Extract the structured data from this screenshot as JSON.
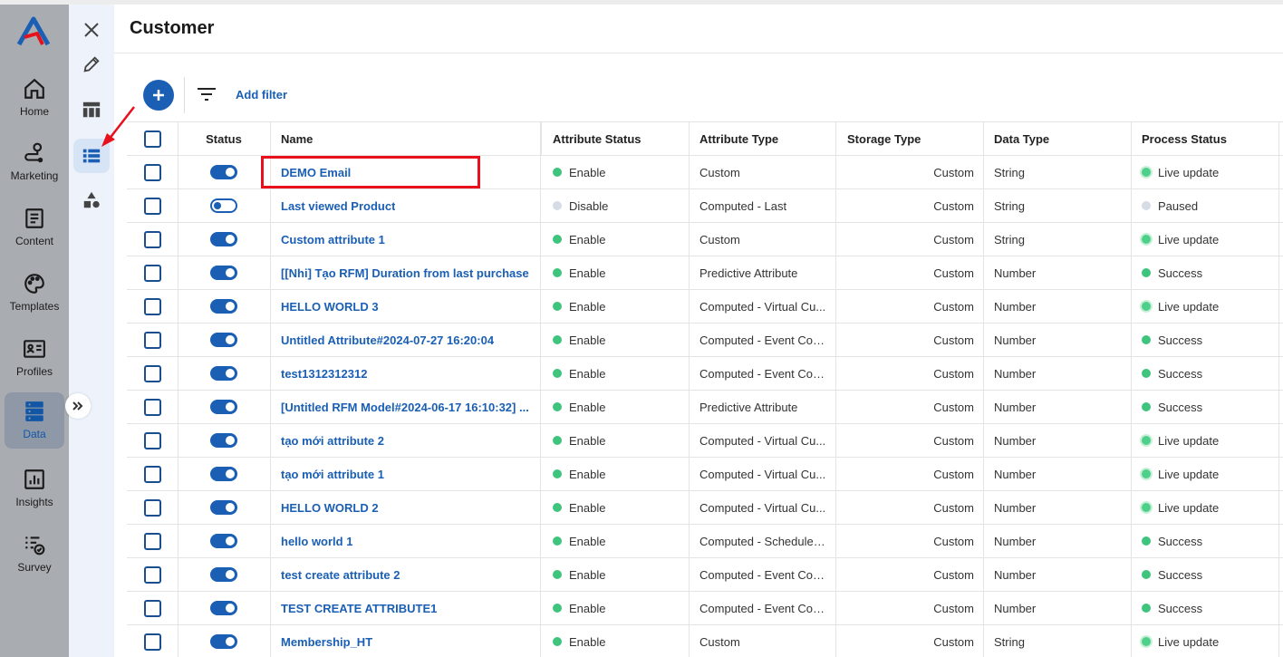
{
  "nav": {
    "items": [
      {
        "label": "Home",
        "icon": "home-icon"
      },
      {
        "label": "Marketing",
        "icon": "marketing-icon"
      },
      {
        "label": "Content",
        "icon": "content-icon"
      },
      {
        "label": "Templates",
        "icon": "palette-icon"
      },
      {
        "label": "Profiles",
        "icon": "profile-card-icon"
      },
      {
        "label": "Data",
        "icon": "database-icon"
      },
      {
        "label": "Insights",
        "icon": "chart-icon"
      },
      {
        "label": "Survey",
        "icon": "survey-icon"
      }
    ],
    "active": "Data"
  },
  "subnav": [
    "close-icon",
    "pencil-icon",
    "table-icon",
    "list-icon",
    "shapes-icon"
  ],
  "page": {
    "title": "Customer"
  },
  "toolbar": {
    "add_filter": "Add filter"
  },
  "table": {
    "headers": {
      "status": "Status",
      "name": "Name",
      "attribute_status": "Attribute Status",
      "attribute_type": "Attribute Type",
      "storage_type": "Storage Type",
      "data_type": "Data Type",
      "process_status": "Process Status"
    },
    "rows": [
      {
        "on": true,
        "name": "DEMO Email",
        "attr_status": "Enable",
        "attr_type": "Custom",
        "storage": "Custom",
        "data_type": "String",
        "process": "Live update"
      },
      {
        "on": false,
        "name": "Last viewed Product",
        "attr_status": "Disable",
        "attr_type": "Computed - Last",
        "storage": "Custom",
        "data_type": "String",
        "process": "Paused"
      },
      {
        "on": true,
        "name": "Custom attribute 1",
        "attr_status": "Enable",
        "attr_type": "Custom",
        "storage": "Custom",
        "data_type": "String",
        "process": "Live update"
      },
      {
        "on": true,
        "name": "[[Nhi] Tạo RFM] Duration from last purchase",
        "attr_status": "Enable",
        "attr_type": "Predictive Attribute",
        "storage": "Custom",
        "data_type": "Number",
        "process": "Success"
      },
      {
        "on": true,
        "name": "HELLO WORLD 3",
        "attr_status": "Enable",
        "attr_type": "Computed - Virtual Cu...",
        "storage": "Custom",
        "data_type": "Number",
        "process": "Live update"
      },
      {
        "on": true,
        "name": "Untitled Attribute#2024-07-27 16:20:04",
        "attr_status": "Enable",
        "attr_type": "Computed - Event Cou...",
        "storage": "Custom",
        "data_type": "Number",
        "process": "Success"
      },
      {
        "on": true,
        "name": "test1312312312",
        "attr_status": "Enable",
        "attr_type": "Computed - Event Cou...",
        "storage": "Custom",
        "data_type": "Number",
        "process": "Success"
      },
      {
        "on": true,
        "name": "[Untitled RFM Model#2024-06-17 16:10:32] ...",
        "attr_status": "Enable",
        "attr_type": "Predictive Attribute",
        "storage": "Custom",
        "data_type": "Number",
        "process": "Success"
      },
      {
        "on": true,
        "name": "tạo mới attribute 2",
        "attr_status": "Enable",
        "attr_type": "Computed - Virtual Cu...",
        "storage": "Custom",
        "data_type": "Number",
        "process": "Live update"
      },
      {
        "on": true,
        "name": "tạo mới attribute 1",
        "attr_status": "Enable",
        "attr_type": "Computed - Virtual Cu...",
        "storage": "Custom",
        "data_type": "Number",
        "process": "Live update"
      },
      {
        "on": true,
        "name": "HELLO WORLD 2",
        "attr_status": "Enable",
        "attr_type": "Computed - Virtual Cu...",
        "storage": "Custom",
        "data_type": "Number",
        "process": "Live update"
      },
      {
        "on": true,
        "name": "hello world 1",
        "attr_status": "Enable",
        "attr_type": "Computed - Schedule ...",
        "storage": "Custom",
        "data_type": "Number",
        "process": "Success"
      },
      {
        "on": true,
        "name": "test create attribute 2",
        "attr_status": "Enable",
        "attr_type": "Computed - Event Cou...",
        "storage": "Custom",
        "data_type": "Number",
        "process": "Success"
      },
      {
        "on": true,
        "name": "TEST CREATE ATTRIBUTE1",
        "attr_status": "Enable",
        "attr_type": "Computed - Event Cou...",
        "storage": "Custom",
        "data_type": "Number",
        "process": "Success"
      },
      {
        "on": true,
        "name": "Membership_HT",
        "attr_status": "Enable",
        "attr_type": "Custom",
        "storage": "Custom",
        "data_type": "String",
        "process": "Live update"
      }
    ]
  },
  "colors": {
    "accent": "#1a5fb4",
    "enable": "#3fc47e",
    "disable": "#d5dce5",
    "highlight": "#e8101a"
  }
}
